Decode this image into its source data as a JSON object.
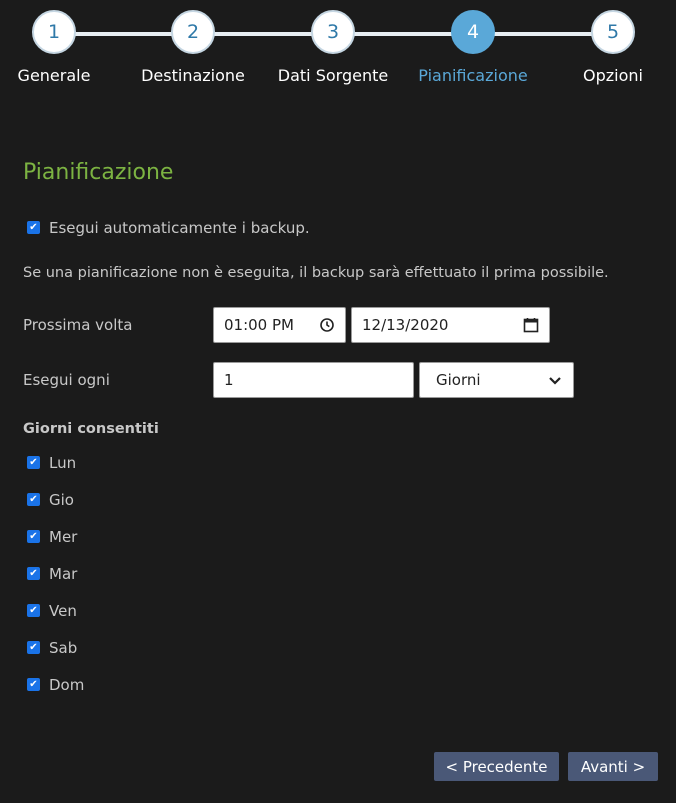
{
  "wizard": {
    "steps": [
      {
        "number": "1",
        "label": "Generale"
      },
      {
        "number": "2",
        "label": "Destinazione"
      },
      {
        "number": "3",
        "label": "Dati Sorgente"
      },
      {
        "number": "4",
        "label": "Pianificazione"
      },
      {
        "number": "5",
        "label": "Opzioni"
      }
    ],
    "active_step": 4
  },
  "section_title": "Pianificazione",
  "auto_backup": {
    "label": "Esegui automaticamente i backup.",
    "checked": true
  },
  "info_text": "Se una pianificazione non è eseguita, il backup sarà effettuato il prima possibile.",
  "next_run": {
    "label": "Prossima volta",
    "time": "01:00 PM",
    "date": "12/13/2020"
  },
  "repeat": {
    "label": "Esegui ogni",
    "value": "1",
    "unit": "Giorni"
  },
  "allowed_days": {
    "title": "Giorni consentiti",
    "days": [
      {
        "label": "Lun",
        "checked": true
      },
      {
        "label": "Gio",
        "checked": true
      },
      {
        "label": "Mer",
        "checked": true
      },
      {
        "label": "Mar",
        "checked": true
      },
      {
        "label": "Ven",
        "checked": true
      },
      {
        "label": "Sab",
        "checked": true
      },
      {
        "label": "Dom",
        "checked": true
      }
    ]
  },
  "buttons": {
    "previous": "< Precedente",
    "next": "Avanti >"
  },
  "colors": {
    "accent": "#5aa8d8",
    "title_green": "#7cb342",
    "button_bg": "#4a5877",
    "checkbox": "#1a73e8"
  }
}
